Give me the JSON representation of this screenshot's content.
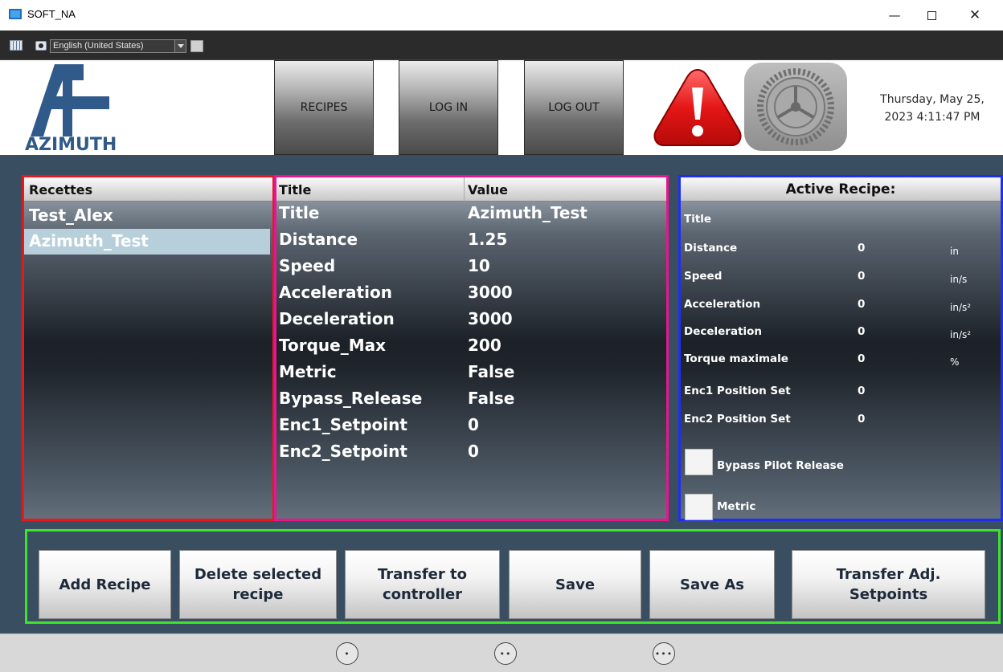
{
  "window": {
    "title": "SOFT_NA"
  },
  "toolbar": {
    "language": "English (United States)"
  },
  "header": {
    "logo_text": "AZIMUTH",
    "recipes_label": "RECIPES",
    "login_label": "LOG IN",
    "logout_label": "LOG OUT",
    "datetime_line1": "Thursday, May 25,",
    "datetime_line2": "2023 4:11:47 PM"
  },
  "recettes": {
    "header": "Recettes",
    "items": [
      "Test_Alex",
      "Azimuth_Test"
    ],
    "selected": "Azimuth_Test"
  },
  "values": {
    "col_title": "Title",
    "col_value": "Value",
    "rows": [
      {
        "key": "Title",
        "value": "Azimuth_Test"
      },
      {
        "key": "Distance",
        "value": "1.25"
      },
      {
        "key": "Speed",
        "value": "10"
      },
      {
        "key": "Acceleration",
        "value": "3000"
      },
      {
        "key": "Deceleration",
        "value": "3000"
      },
      {
        "key": "Torque_Max",
        "value": "200"
      },
      {
        "key": "Metric",
        "value": "False"
      },
      {
        "key": "Bypass_Release",
        "value": "False"
      },
      {
        "key": "Enc1_Setpoint",
        "value": "0"
      },
      {
        "key": "Enc2_Setpoint",
        "value": "0"
      }
    ]
  },
  "active": {
    "header": "Active Recipe:",
    "title_label": "Title",
    "rows": [
      {
        "key": "Distance",
        "value": "0",
        "unit": "in"
      },
      {
        "key": "Speed",
        "value": "0",
        "unit": "in/s"
      },
      {
        "key": "Acceleration",
        "value": "0",
        "unit": "in/s²"
      },
      {
        "key": "Deceleration",
        "value": "0",
        "unit": "in/s²"
      },
      {
        "key": "Torque maximale",
        "value": "0",
        "unit": "%"
      },
      {
        "key": "Enc1 Position Set",
        "value": "0",
        "unit": ""
      },
      {
        "key": "Enc2 Position Set",
        "value": "0",
        "unit": ""
      }
    ],
    "bypass_label": "Bypass Pilot Release",
    "metric_label": "Metric"
  },
  "actions": {
    "add_recipe": "Add Recipe",
    "delete_recipe_l1": "Delete selected",
    "delete_recipe_l2": "recipe",
    "transfer_l1": "Transfer to",
    "transfer_l2": "controller",
    "save": "Save",
    "save_as": "Save As",
    "transfer_adj_l1": "Transfer Adj.",
    "transfer_adj_l2": "Setpoints"
  },
  "colors": {
    "recettes_border": "#e8191e",
    "values_border": "#e8158e",
    "active_border": "#1e2ff0",
    "actions_border": "#3ee42a",
    "background": "#3a4e62"
  },
  "icons": [
    "app-icon",
    "grid-icon",
    "camera-icon",
    "alarm-icon",
    "gear-icon",
    "minimize-icon",
    "maximize-icon",
    "close-icon"
  ]
}
